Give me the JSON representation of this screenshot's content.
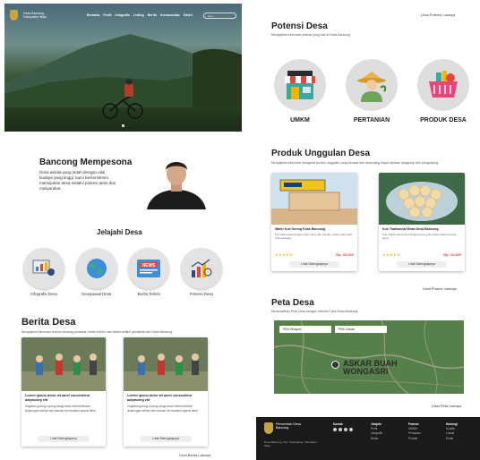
{
  "hero": {
    "brand_line1": "Desa Bancong",
    "brand_line2": "Kabupaten Wajo",
    "menu": [
      "Beranda",
      "Profil",
      "Infografis",
      "Listing",
      "Berita",
      "Kommunitas",
      "Galeri"
    ],
    "search_placeholder": "Cari..."
  },
  "bancong": {
    "title": "Bancong Mempesona",
    "text": "Desa wisata yang indah dengan nilai budaya yang tinggi, kami berkomitmen memajukan desa melalui potensi alam dan masyarakat."
  },
  "jelajahi": {
    "title": "Jelajahi Desa",
    "items": [
      {
        "label": "Infografis Desa",
        "icon": "infographic-icon"
      },
      {
        "label": "Geospasial Desa",
        "icon": "globe-icon"
      },
      {
        "label": "Berita Terkini",
        "icon": "news-icon"
      },
      {
        "label": "Potensi Desa",
        "icon": "chart-icon"
      }
    ]
  },
  "berita": {
    "title": "Berita Desa",
    "subtitle": "Menyajikan informasi terbaru tentang peristiwa, berita terkini, dan artikel-artikel jurnalistik dari Desa Bancong",
    "cards": [
      {
        "title": "Lorem ipsum dolor sit amet consectetur adipiscing elit",
        "body": "Kegiatan gotong royong warga desa membersihkan lingkungan sekitar dan saluran air bersama aparat desa.",
        "button": "Lihat Selengkapnya"
      },
      {
        "title": "Lorem ipsum dolor sit amet consectetur adipiscing elit",
        "body": "Kegiatan gotong royong warga desa membersihkan lingkungan sekitar dan saluran air bersama aparat desa.",
        "button": "Lihat Selengkapnya"
      }
    ],
    "more": "Lihat Berita Lainnya"
  },
  "potensi": {
    "top_link": "Lihat Potensi Lainnya",
    "title": "Potensi Desa",
    "subtitle": "Menyajikan informasi potensi yang ada di Desa Bancong",
    "items": [
      {
        "label": "UMKM",
        "icon": "shop-icon"
      },
      {
        "label": "PERTANIAN",
        "icon": "farmer-icon"
      },
      {
        "label": "PRODUK DESA",
        "icon": "basket-icon"
      }
    ]
  },
  "produk": {
    "title": "Produk Unggulan Desa",
    "subtitle": "Menyajikan informasi mengenai produk unggulan yang berasal dari desa yang dapat dipesan langsung oleh pengunjung",
    "cards": [
      {
        "name": "Wafer Kue Kering Khas Bancong",
        "desc": "Kue khas desa dengan rasa manis dan renyah, cocok untuk oleh-oleh keluarga.",
        "stars": "★★★★★",
        "price": "Rp. 25.000",
        "button": "Lihat Selengkapnya"
      },
      {
        "name": "Kue Tradisional Khas Desa Bancong",
        "desc": "Kue tradisional lembut dengan isian gula merah buatan warga desa.",
        "stars": "★★★★★",
        "price": "Rp. 15.000",
        "button": "Lihat Selengkapnya"
      }
    ],
    "more": "Lihat Produk Lainnya"
  },
  "peta": {
    "title": "Peta Desa",
    "subtitle": "Menampilkan Peta Desa dengan Interest Point Desa Bancong",
    "select1": "Pilih Wilayah",
    "select2": "Pilih Lokasi",
    "map_label_line1": "ASKAR BUAH",
    "map_label_line2": "WONGASRI",
    "more": "Lihat Peta Lainnya"
  },
  "footer": {
    "brand_line1": "Pemerintah Desa",
    "brand_line2": "Bancong",
    "address": "Desa Bancong, Kec. Sajoanging, Kabupaten Wajo",
    "col1_title": "Kontak",
    "col2_title": "Jelajahi",
    "col2_items": [
      "Profil",
      "Infografis",
      "Berita"
    ],
    "col3_title": "Potensi",
    "col3_items": [
      "UMKM",
      "Pertanian",
      "Produk"
    ],
    "col4_title": "Hubungi",
    "col4_items": [
      "Kontak",
      "Lokasi",
      "Email"
    ]
  }
}
